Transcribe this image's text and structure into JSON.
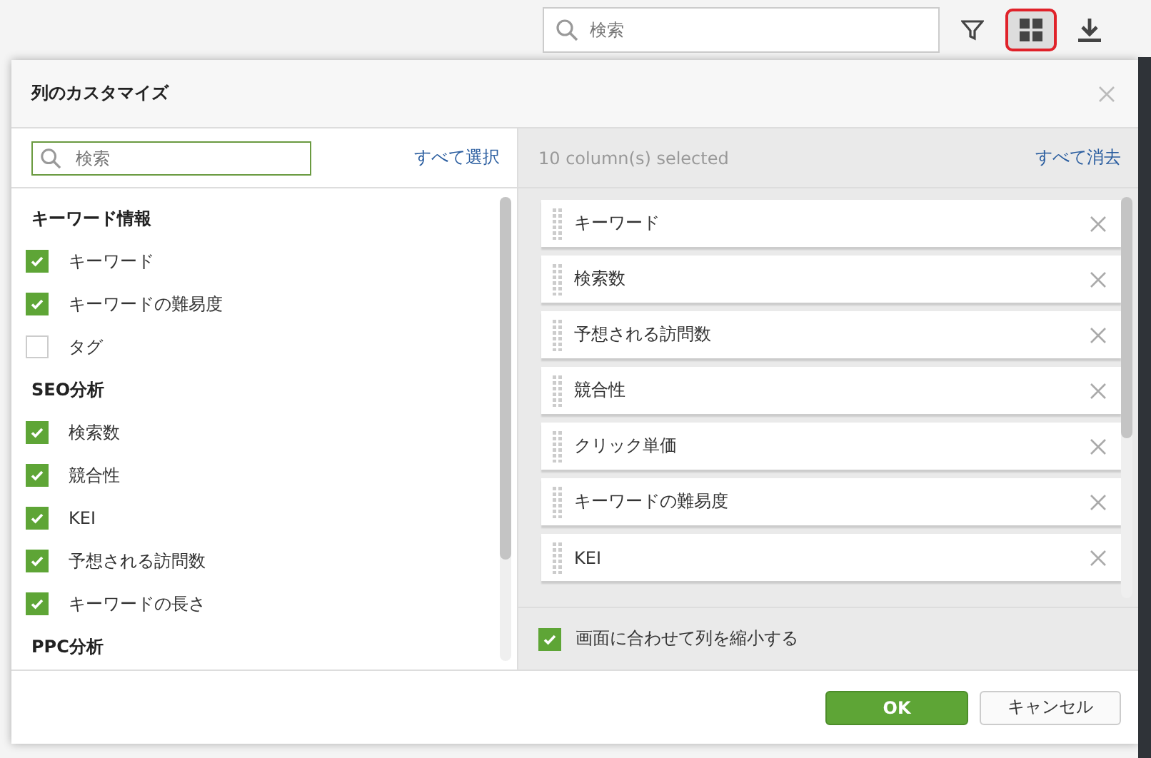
{
  "toolbar": {
    "search": {
      "placeholder": "検索"
    },
    "grid_button": {
      "selected": true
    }
  },
  "dialog": {
    "title": "列のカスタマイズ",
    "left": {
      "search": {
        "placeholder": "検索"
      },
      "select_all": "すべて選択",
      "groups": [
        {
          "title": "キーワード情報",
          "items": [
            {
              "label": "キーワード",
              "checked": true
            },
            {
              "label": "キーワードの難易度",
              "checked": true
            },
            {
              "label": "タグ",
              "checked": false
            }
          ]
        },
        {
          "title": "SEO分析",
          "items": [
            {
              "label": "検索数",
              "checked": true
            },
            {
              "label": "競合性",
              "checked": true
            },
            {
              "label": "KEI",
              "checked": true
            },
            {
              "label": "予想される訪問数",
              "checked": true
            },
            {
              "label": "キーワードの長さ",
              "checked": true
            }
          ]
        },
        {
          "title": "PPC分析"
        }
      ]
    },
    "right": {
      "count": "10 column(s) selected",
      "clear_all": "すべて消去",
      "columns": [
        "キーワード",
        "検索数",
        "予想される訪問数",
        "競合性",
        "クリック単価",
        "キーワードの難易度",
        "KEI"
      ],
      "shrink": {
        "label": "画面に合わせて列を縮小する",
        "checked": true
      }
    },
    "buttons": {
      "ok": "OK",
      "cancel": "キャンセル"
    }
  }
}
